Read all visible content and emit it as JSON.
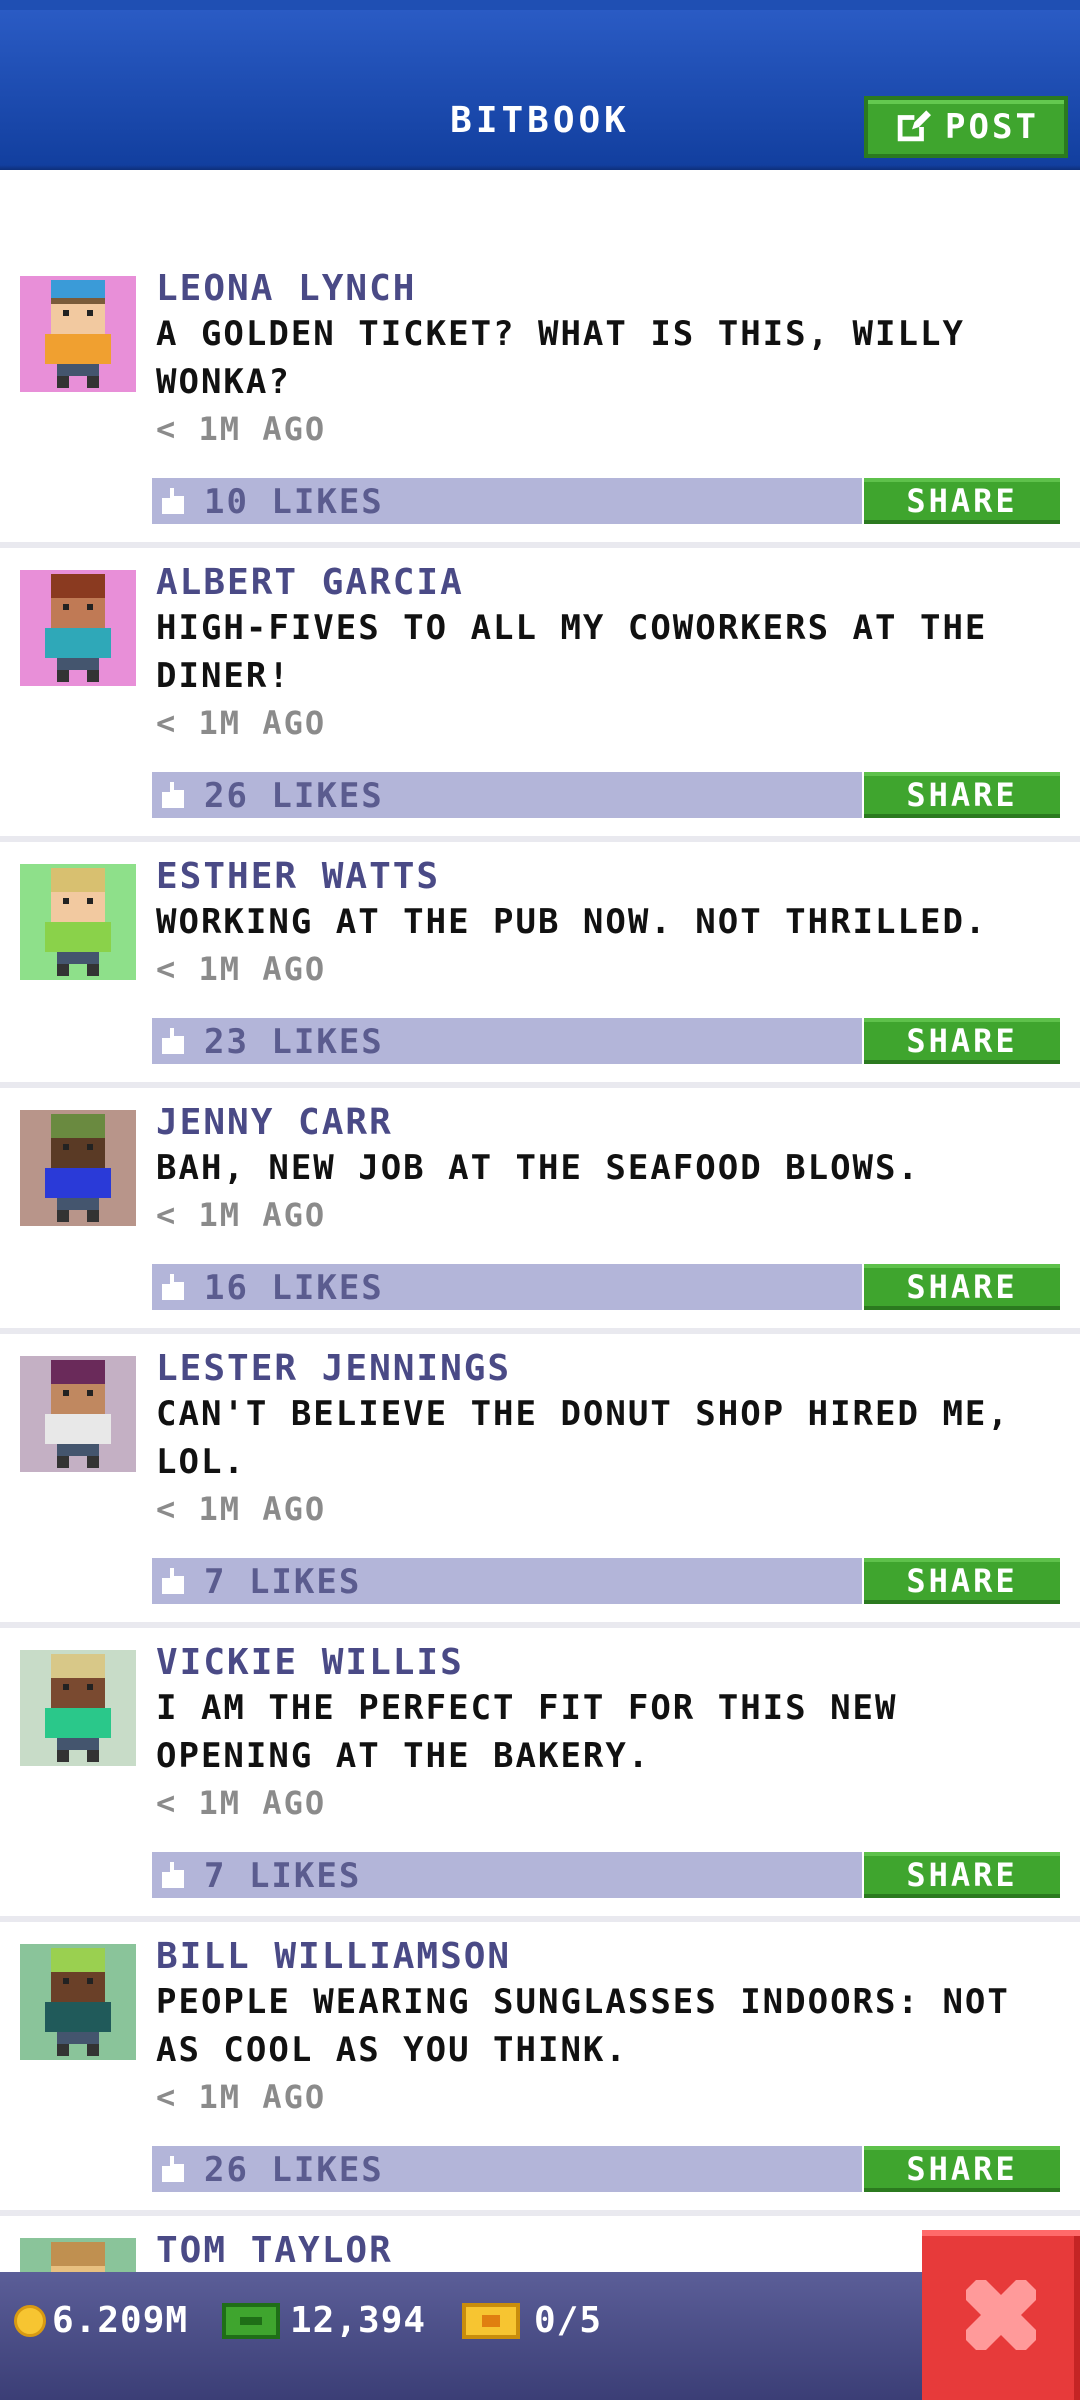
{
  "header": {
    "title": "BITBOOK",
    "post_label": "POST"
  },
  "posts": [
    {
      "name": "LEONA LYNCH",
      "text": "A GOLDEN TICKET? WHAT IS THIS, WILLY WONKA?",
      "time": "< 1M AGO",
      "likes": "10 LIKES",
      "share": "SHARE",
      "avatar_bg": "#e88fd8",
      "skin": "#f2c9a0",
      "hair": "#7a5b3a",
      "shirt": "#f0a030",
      "hat": "#3a9bd8"
    },
    {
      "name": "ALBERT GARCIA",
      "text": "HIGH-FIVES TO ALL MY COWORKERS AT THE DINER!",
      "time": "< 1M AGO",
      "likes": "26 LIKES",
      "share": "SHARE",
      "avatar_bg": "#e88fd8",
      "skin": "#c07a55",
      "hair": "#8a3a20",
      "shirt": "#2fa8b8",
      "hat": "#8a3a20"
    },
    {
      "name": "ESTHER WATTS",
      "text": "WORKING AT THE PUB NOW. NOT THRILLED.",
      "time": "< 1M AGO",
      "likes": "23 LIKES",
      "share": "SHARE",
      "avatar_bg": "#8ee08a",
      "skin": "#f2c9a0",
      "hair": "#d8c070",
      "shirt": "#8ad24a",
      "hat": "#d8c070"
    },
    {
      "name": "JENNY CARR",
      "text": "BAH, NEW JOB AT THE SEAFOOD BLOWS.",
      "time": "< 1M AGO",
      "likes": "16 LIKES",
      "share": "SHARE",
      "avatar_bg": "#b8958a",
      "skin": "#5a3a25",
      "hair": "#6a8a40",
      "shirt": "#2a3ad8",
      "hat": "#6a8a40"
    },
    {
      "name": "LESTER JENNINGS",
      "text": "CAN'T BELIEVE THE DONUT SHOP HIRED ME, LOL.",
      "time": "< 1M AGO",
      "likes": "7 LIKES",
      "share": "SHARE",
      "avatar_bg": "#c4b0c4",
      "skin": "#c08860",
      "hair": "#6a2a5a",
      "shirt": "#e8e8e8",
      "hat": "#6a2a5a"
    },
    {
      "name": "VICKIE WILLIS",
      "text": "I AM THE PERFECT FIT FOR THIS NEW OPENING AT THE BAKERY.",
      "time": "< 1M AGO",
      "likes": "7 LIKES",
      "share": "SHARE",
      "avatar_bg": "#c8dcc8",
      "skin": "#7a4a30",
      "hair": "#d8c888",
      "shirt": "#2ac88a",
      "hat": "#d8c888"
    },
    {
      "name": "BILL WILLIAMSON",
      "text": "PEOPLE WEARING SUNGLASSES INDOORS: NOT AS COOL AS YOU THINK.",
      "time": "< 1M AGO",
      "likes": "26 LIKES",
      "share": "SHARE",
      "avatar_bg": "#8ac49a",
      "skin": "#6a4028",
      "hair": "#9ad050",
      "shirt": "#205a5a",
      "hat": "#9ad050"
    },
    {
      "name": "TOM TAYLOR",
      "avatar_bg": "#8ac49a",
      "skin": "#e8c080",
      "hair": "#c09050",
      "shirt": "#c09050",
      "hat": "#c09050"
    }
  ],
  "footer": {
    "coins": "6.209M",
    "bux": "12,394",
    "tickets": "0/5"
  }
}
